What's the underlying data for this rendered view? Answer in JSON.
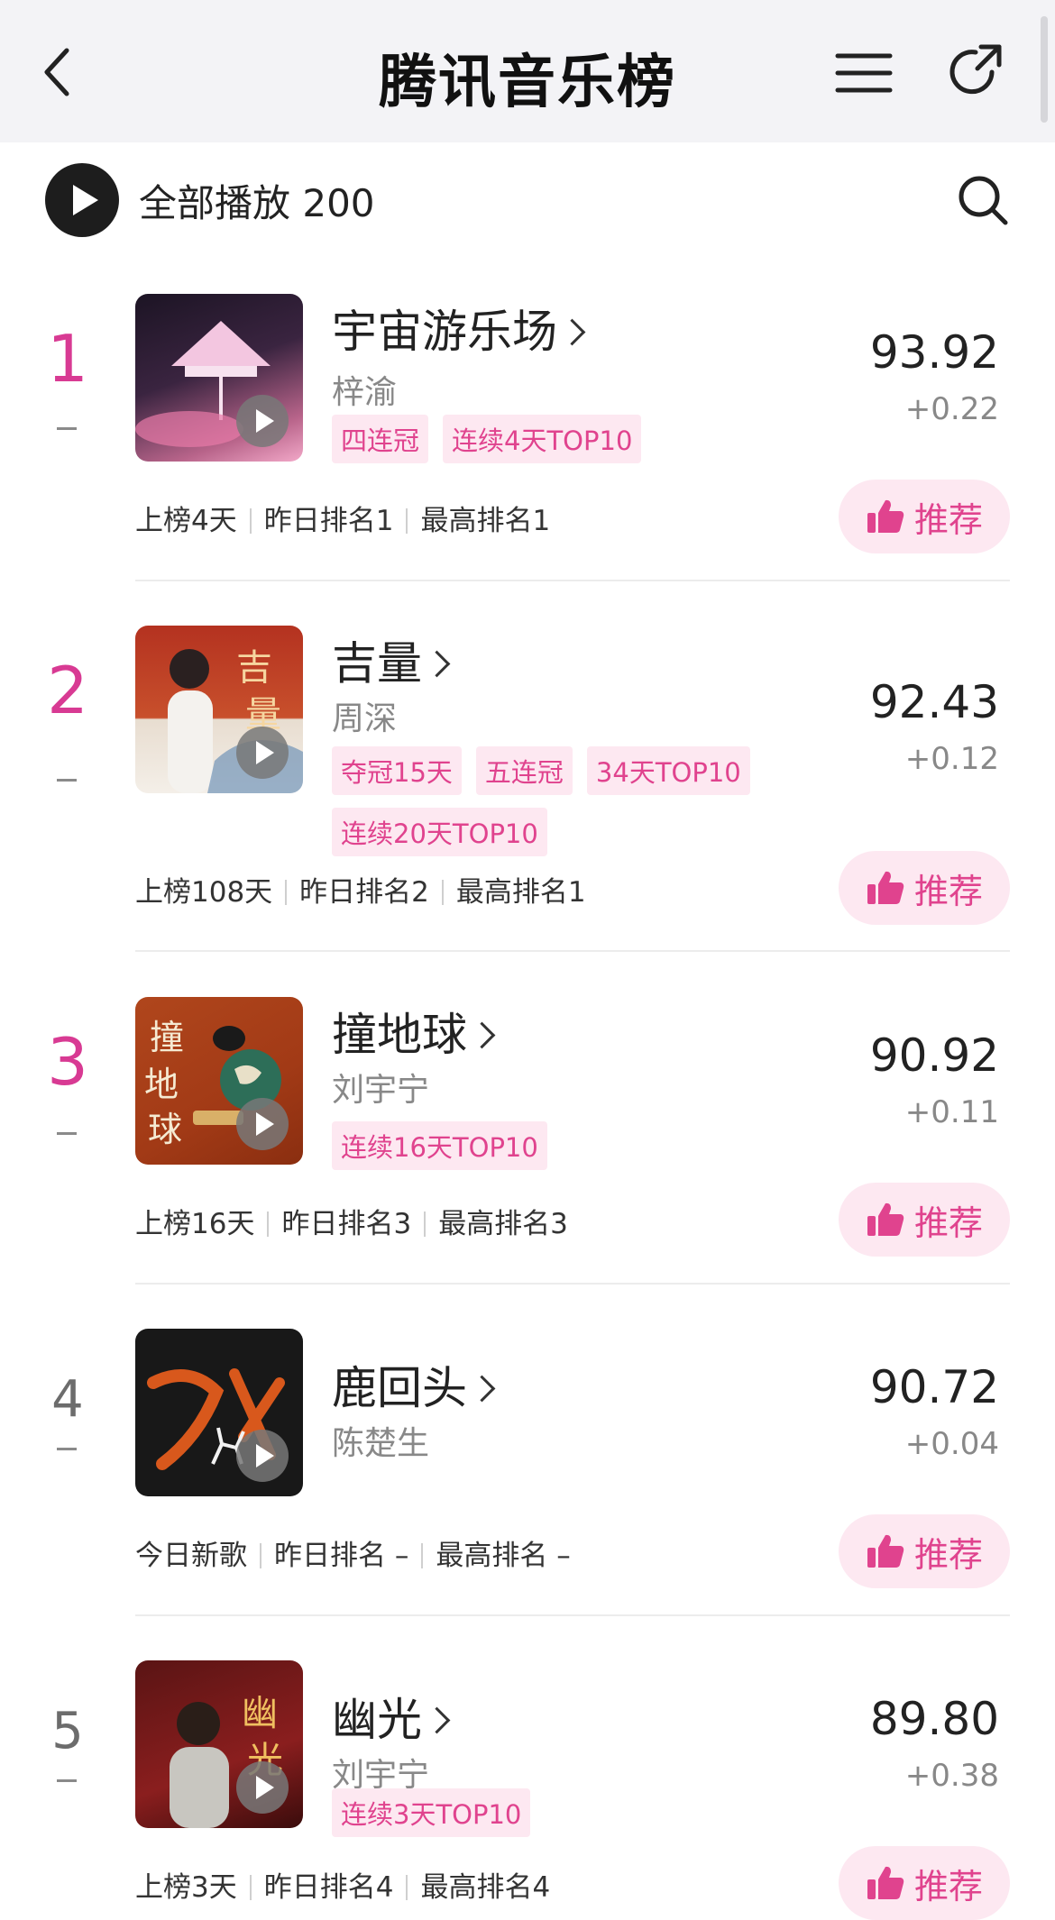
{
  "header": {
    "title": "腾讯音乐榜"
  },
  "play_all": {
    "label": "全部播放 200"
  },
  "colors": {
    "accent": "#e0438e",
    "rank_top": "#d83a93",
    "tag_bg": "#fde8f1"
  },
  "songs": [
    {
      "rank": "1",
      "title": "宇宙游乐场",
      "artist": "梓渝",
      "tags": [
        "四连冠",
        "连续4天TOP10"
      ],
      "score": "93.92",
      "delta": "+0.22",
      "on_chart": "上榜4天",
      "yesterday": "昨日排名1",
      "peak": "最高排名1",
      "recommend": "推荐"
    },
    {
      "rank": "2",
      "title": "吉量",
      "artist": "周深",
      "tags": [
        "夺冠15天",
        "五连冠",
        "34天TOP10",
        "连续20天TOP10"
      ],
      "score": "92.43",
      "delta": "+0.12",
      "on_chart": "上榜108天",
      "yesterday": "昨日排名2",
      "peak": "最高排名1",
      "recommend": "推荐"
    },
    {
      "rank": "3",
      "title": "撞地球",
      "artist": "刘宇宁",
      "tags": [
        "连续16天TOP10"
      ],
      "score": "90.92",
      "delta": "+0.11",
      "on_chart": "上榜16天",
      "yesterday": "昨日排名3",
      "peak": "最高排名3",
      "recommend": "推荐"
    },
    {
      "rank": "4",
      "title": "鹿回头",
      "artist": "陈楚生",
      "tags": [],
      "score": "90.72",
      "delta": "+0.04",
      "on_chart": "今日新歌",
      "yesterday": "昨日排名 –",
      "peak": "最高排名 –",
      "recommend": "推荐"
    },
    {
      "rank": "5",
      "title": "幽光",
      "artist": "刘宇宁",
      "tags": [
        "连续3天TOP10"
      ],
      "score": "89.80",
      "delta": "+0.38",
      "on_chart": "上榜3天",
      "yesterday": "昨日排名4",
      "peak": "最高排名4",
      "recommend": "推荐"
    }
  ]
}
